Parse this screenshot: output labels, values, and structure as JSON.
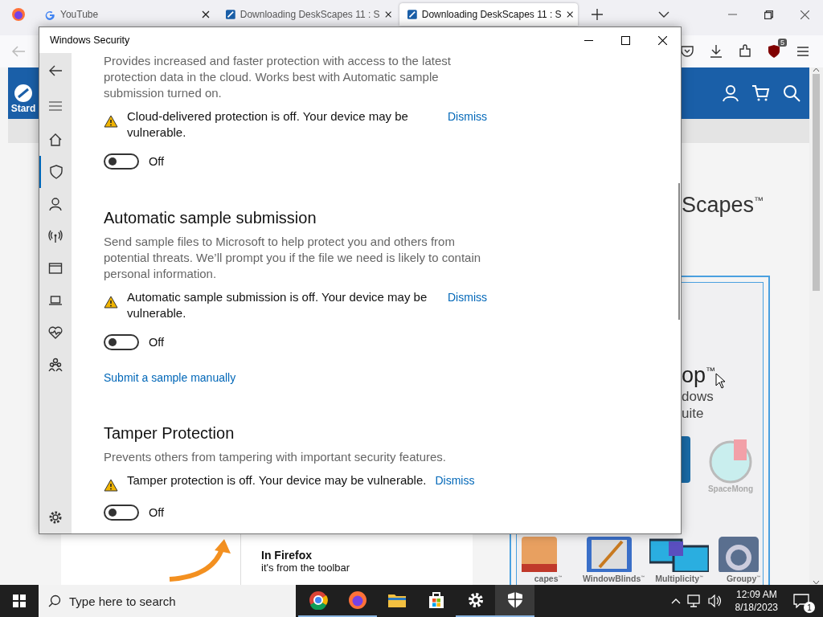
{
  "browser": {
    "tabs": [
      {
        "title": "YouTube",
        "selected": false
      },
      {
        "title": "Downloading DeskScapes 11 : S",
        "selected": false
      },
      {
        "title": "Downloading DeskScapes 11 : S",
        "selected": true
      }
    ],
    "extension_badge": "5",
    "site": {
      "logo": "Stard",
      "headline": "Scapes$^{™}$",
      "promo": {
        "title": "op$^{™}$",
        "lines": [
          "dows",
          "uite"
        ],
        "side_product": "SpaceMong",
        "products": [
          "capes$^{™}$",
          "WindowBlinds$^{™}$",
          "Multiplicity$^{™}$",
          "Groupy$^{™}$"
        ]
      },
      "tip": {
        "title": "In Firefox",
        "text": "it's from the toolbar"
      }
    }
  },
  "security": {
    "title": "Windows Security",
    "nav": [
      {
        "selected": false
      },
      {
        "selected": true
      },
      {
        "selected": false
      },
      {
        "selected": false
      },
      {
        "selected": false
      },
      {
        "selected": false
      },
      {
        "selected": false
      },
      {
        "selected": false
      }
    ],
    "sections": [
      {
        "description": "Provides increased and faster protection with access to the latest protection data in the cloud. Works best with Automatic sample submission turned on.",
        "warning": "Cloud-delivered protection is off. Your device may be vulnerable.",
        "dismiss": "Dismiss",
        "toggle": {
          "on": false,
          "label": "Off"
        }
      },
      {
        "heading": "Automatic sample submission",
        "description": "Send sample files to Microsoft to help protect you and others from potential threats. We’ll prompt you if the file we need is likely to contain personal information.",
        "warning": "Automatic sample submission is off. Your device may be vulnerable.",
        "dismiss": "Dismiss",
        "toggle": {
          "on": false,
          "label": "Off"
        },
        "link": "Submit a sample manually"
      },
      {
        "heading": "Tamper Protection",
        "description": "Prevents others from tampering with important security features.",
        "warning": "Tamper protection is off. Your device may be vulnerable.",
        "dismiss": "Dismiss",
        "toggle": {
          "on": false,
          "label": "Off"
        }
      }
    ]
  },
  "taskbar": {
    "search_placeholder": "Type here to search",
    "apps": [
      {
        "open": true,
        "selected": false
      },
      {
        "open": true,
        "selected": false
      },
      {
        "open": false,
        "selected": false
      },
      {
        "open": false,
        "selected": false
      },
      {
        "open": true,
        "selected": false
      },
      {
        "open": true,
        "selected": true
      }
    ],
    "time": "12:09 AM",
    "date": "8/18/2023",
    "notifications": "1"
  }
}
